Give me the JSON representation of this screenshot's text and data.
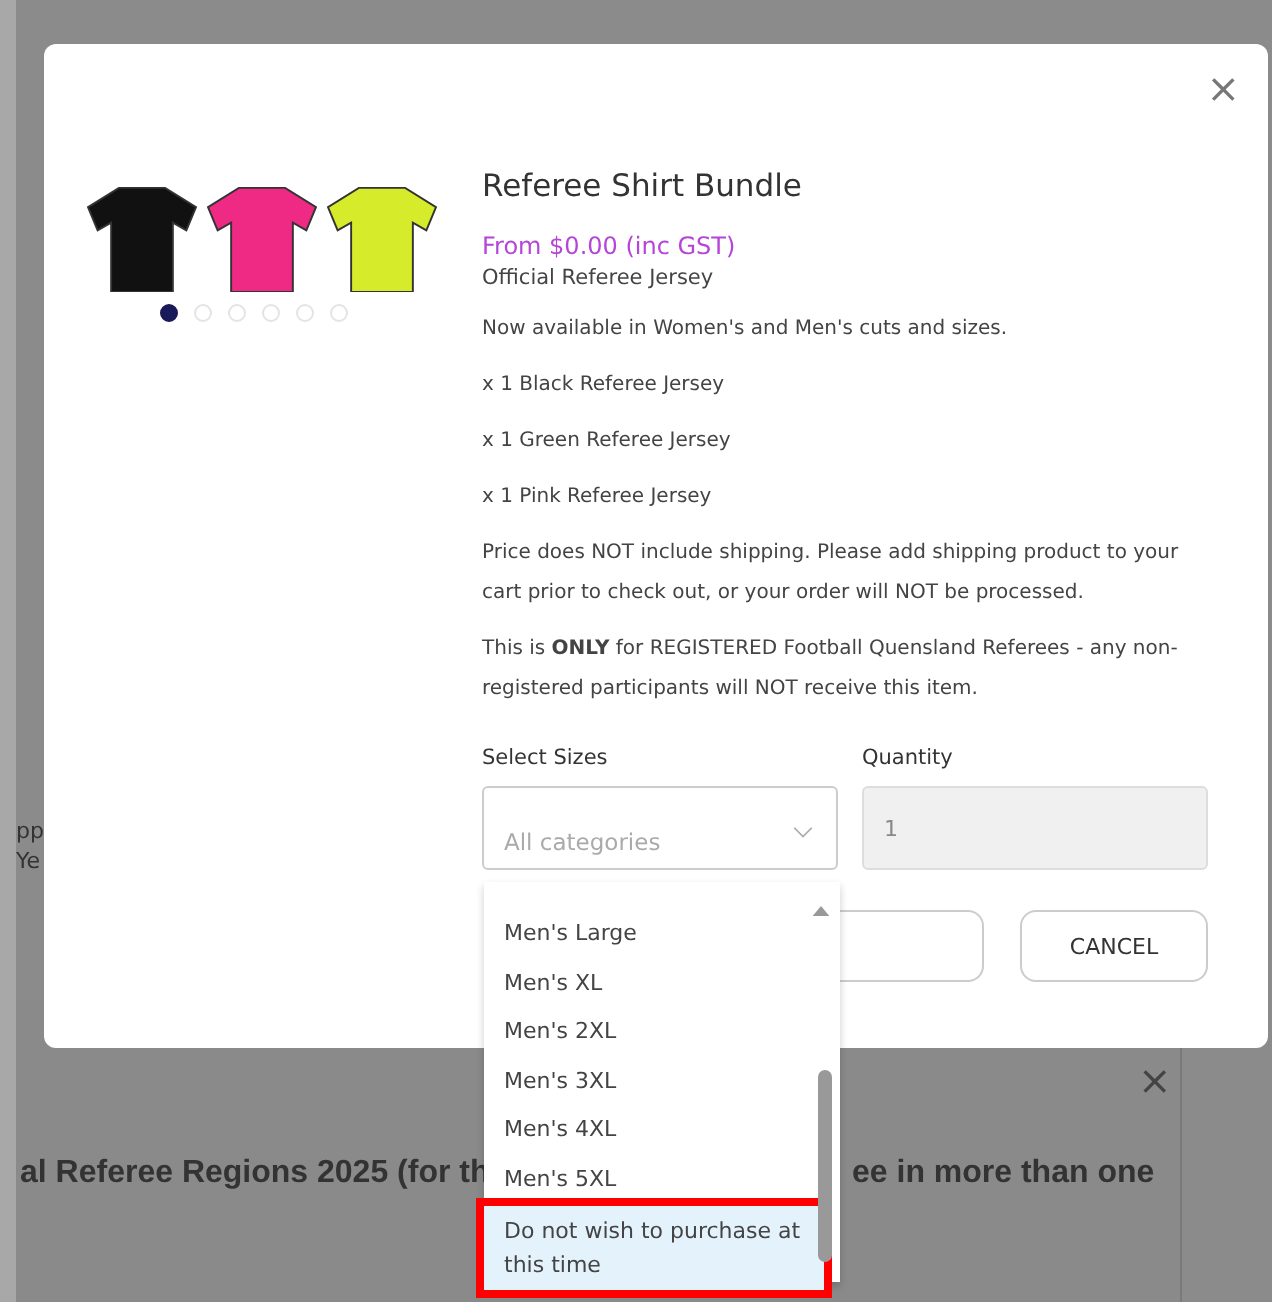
{
  "background": {
    "left_fragments": [
      "pp",
      "Ye"
    ],
    "heading_start": "al Referee Regions 2025 (for th",
    "heading_end": "ee in more than one",
    "close": "×"
  },
  "modal": {
    "close": "×",
    "shirts": [
      {
        "color": "#111111"
      },
      {
        "color": "#ee2a84"
      },
      {
        "color": "#d6ec2a"
      }
    ],
    "dots": [
      {
        "selected": true
      },
      {
        "selected": false
      },
      {
        "selected": false
      },
      {
        "selected": false
      },
      {
        "selected": false
      },
      {
        "selected": false
      }
    ],
    "title": "Referee Shirt Bundle",
    "price": "From $0.00 (inc GST)",
    "subtitle": "Official Referee Jersey",
    "paragraphs": [
      "Now available in Women's and Men's cuts and sizes.",
      "x 1 Black Referee Jersey",
      "x 1 Green Referee Jersey",
      "x 1 Pink Referee Jersey",
      "Price does NOT include shipping. Please add shipping product to your cart prior to check out, or your order will NOT be processed.",
      "This is **ONLY** for REGISTERED Football Quensland Referees - any non-registered participants will NOT receive this item."
    ],
    "sizes": {
      "label": "Select Sizes",
      "placeholder": "All categories"
    },
    "quantity": {
      "label": "Quantity",
      "value": "1"
    },
    "cancel": "CANCEL",
    "dropdown": {
      "options": [
        {
          "label": "Men's Large",
          "selected": false,
          "marked": false
        },
        {
          "label": "Men's XL",
          "selected": false,
          "marked": false
        },
        {
          "label": "Men's 2XL",
          "selected": false,
          "marked": false
        },
        {
          "label": "Men's 3XL",
          "selected": false,
          "marked": false
        },
        {
          "label": "Men's 4XL",
          "selected": false,
          "marked": false
        },
        {
          "label": "Men's 5XL",
          "selected": false,
          "marked": false
        },
        {
          "label": "Do not wish to purchase at this time",
          "selected": true,
          "marked": true
        }
      ]
    }
  }
}
